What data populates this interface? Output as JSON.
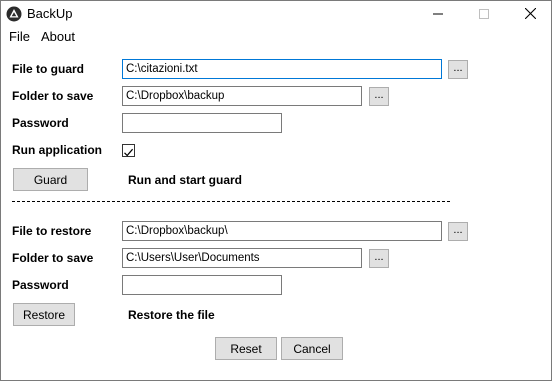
{
  "window": {
    "title": "BackUp"
  },
  "menu": {
    "file": "File",
    "about": "About"
  },
  "guard": {
    "file_label": "File to guard",
    "file_value": "C:\\citazioni.txt",
    "folder_label": "Folder to save",
    "folder_value": "C:\\Dropbox\\backup",
    "password_label": "Password",
    "password_value": "",
    "run_app_label": "Run application",
    "run_app_checked": true,
    "button_label": "Guard",
    "status_text": "Run and start guard"
  },
  "restore": {
    "file_label": "File to restore",
    "file_value": "C:\\Dropbox\\backup\\",
    "folder_label": "Folder to save",
    "folder_value": "C:\\Users\\User\\Documents",
    "password_label": "Password",
    "password_value": "",
    "button_label": "Restore",
    "status_text": "Restore the file"
  },
  "browse_label": "...",
  "footer": {
    "reset_label": "Reset",
    "cancel_label": "Cancel"
  },
  "icons": {
    "app": "app-logo-icon",
    "minimize": "minimize-icon",
    "maximize": "maximize-icon",
    "close": "close-icon",
    "checkmark": "checkmark-icon"
  }
}
